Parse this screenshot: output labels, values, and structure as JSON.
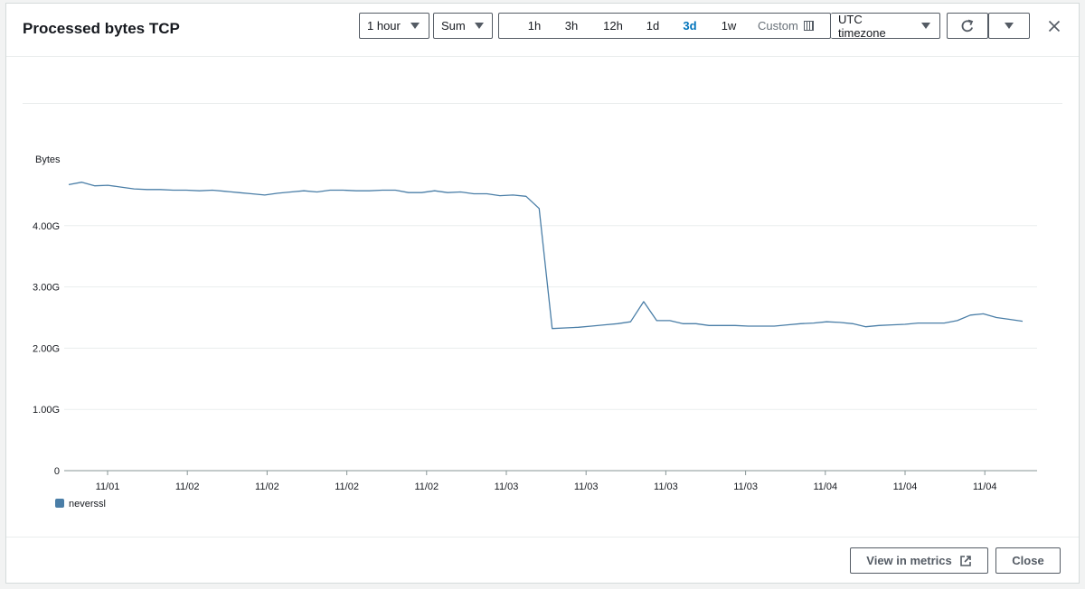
{
  "header": {
    "title": "Processed bytes TCP",
    "period": "1 hour",
    "statistic": "Sum",
    "ranges": [
      "1h",
      "3h",
      "12h",
      "1d",
      "3d",
      "1w"
    ],
    "active_range": "3d",
    "custom_label": "Custom",
    "timezone": "UTC timezone"
  },
  "footer": {
    "view_metrics_label": "View in metrics",
    "close_label": "Close"
  },
  "colors": {
    "series": "#4a7ea7",
    "active": "#0073bb",
    "grid": "#eaeded"
  },
  "chart_data": {
    "type": "line",
    "ylabel": "Bytes",
    "ylim": [
      0,
      5.0
    ],
    "y_unit": "G",
    "yticks": [
      {
        "value": 0,
        "label": "0"
      },
      {
        "value": 1,
        "label": "1.00G"
      },
      {
        "value": 2,
        "label": "2.00G"
      },
      {
        "value": 3,
        "label": "3.00G"
      },
      {
        "value": 4,
        "label": "4.00G"
      }
    ],
    "xticks": [
      "11/01",
      "11/02",
      "11/02",
      "11/02",
      "11/02",
      "11/03",
      "11/03",
      "11/03",
      "11/03",
      "11/04",
      "11/04",
      "11/04"
    ],
    "grid": true,
    "legend": "bottom-left",
    "series": [
      {
        "name": "neverssl",
        "values": [
          4.67,
          4.71,
          4.65,
          4.66,
          4.63,
          4.6,
          4.59,
          4.59,
          4.58,
          4.58,
          4.57,
          4.58,
          4.56,
          4.54,
          4.52,
          4.5,
          4.53,
          4.55,
          4.57,
          4.55,
          4.58,
          4.58,
          4.57,
          4.57,
          4.58,
          4.58,
          4.54,
          4.54,
          4.57,
          4.54,
          4.55,
          4.52,
          4.52,
          4.49,
          4.5,
          4.48,
          4.28,
          2.32,
          2.33,
          2.34,
          2.36,
          2.38,
          2.4,
          2.43,
          2.76,
          2.45,
          2.45,
          2.4,
          2.4,
          2.37,
          2.37,
          2.37,
          2.36,
          2.36,
          2.36,
          2.38,
          2.4,
          2.41,
          2.43,
          2.42,
          2.4,
          2.35,
          2.37,
          2.38,
          2.39,
          2.41,
          2.41,
          2.41,
          2.45,
          2.54,
          2.56,
          2.5,
          2.47,
          2.44
        ]
      }
    ]
  }
}
